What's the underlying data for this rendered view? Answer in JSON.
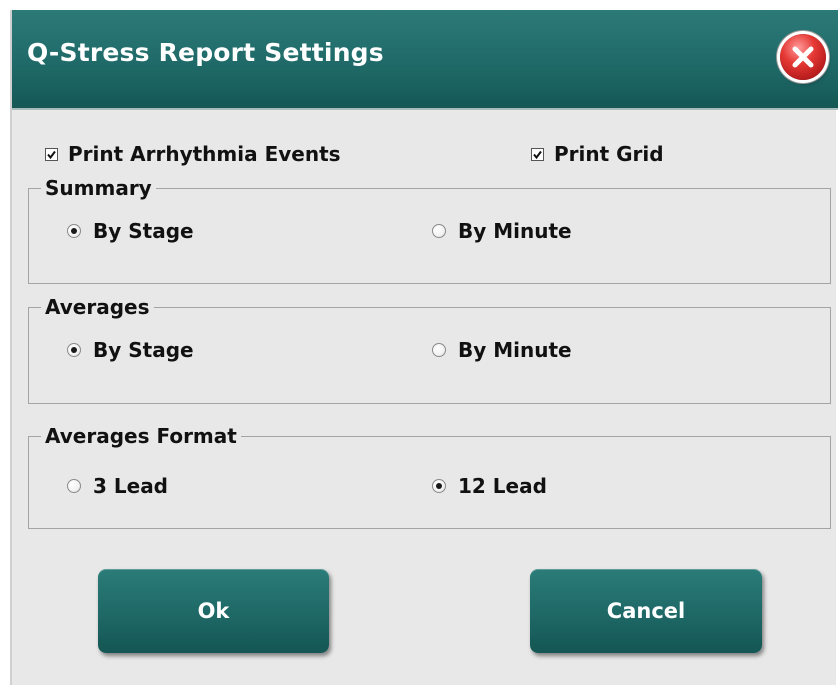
{
  "dialog": {
    "title": "Q-Stress Report Settings",
    "close_icon": "close-icon",
    "colors": {
      "title_bar": "#1f6a68",
      "button": "#1e6866",
      "background": "#e8e8e8",
      "close": "#e53935"
    }
  },
  "options": {
    "print_arrhythmia": {
      "label": "Print Arrhythmia Events",
      "checked": true
    },
    "print_grid": {
      "label": "Print Grid",
      "checked": true
    }
  },
  "summary": {
    "title": "Summary",
    "options": [
      {
        "label": "By Stage",
        "selected": true
      },
      {
        "label": "By Minute",
        "selected": false
      }
    ]
  },
  "averages": {
    "title": "Averages",
    "options": [
      {
        "label": "By Stage",
        "selected": true
      },
      {
        "label": "By Minute",
        "selected": false
      }
    ]
  },
  "averages_format": {
    "title": "Averages Format",
    "options": [
      {
        "label": "3 Lead",
        "selected": false
      },
      {
        "label": "12 Lead",
        "selected": true
      }
    ]
  },
  "buttons": {
    "ok": "Ok",
    "cancel": "Cancel"
  }
}
